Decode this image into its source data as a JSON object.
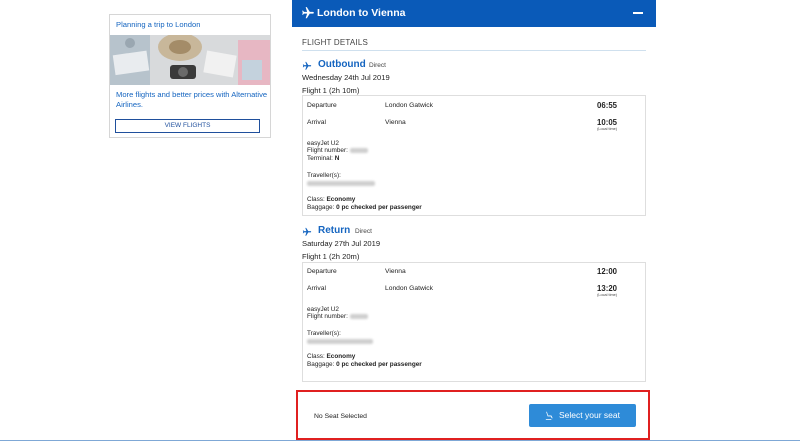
{
  "promo": {
    "title": "Planning a trip to London",
    "text": "More flights and better prices with Alternative Airlines.",
    "button_label": "VIEW FLIGHTS"
  },
  "header": {
    "title": "London to Vienna",
    "collapse_icon": "minus-icon"
  },
  "details": {
    "section_title": "FLIGHT DETAILS"
  },
  "outbound": {
    "name": "Outbound",
    "type": "Direct",
    "date": "Wednesday 24th Jul 2019",
    "flight": "Flight 1 (2h 10m)",
    "departure_label": "Departure",
    "departure_place": "London Gatwick",
    "departure_time": "06:55",
    "arrival_label": "Arrival",
    "arrival_place": "Vienna",
    "arrival_time": "10:05",
    "local_time": "(Local time)",
    "carrier": "easyJet U2",
    "flight_number_label": "Flight number:",
    "terminal_label": "Terminal:",
    "terminal_value": "N",
    "travellers_label": "Traveller(s):",
    "class_label": "Class:",
    "class_value": "Economy",
    "baggage_label": "Baggage:",
    "baggage_value": "0 pc checked per passenger"
  },
  "return": {
    "name": "Return",
    "type": "Direct",
    "date": "Saturday 27th Jul 2019",
    "flight": "Flight 1 (2h 20m)",
    "departure_label": "Departure",
    "departure_place": "Vienna",
    "departure_time": "12:00",
    "arrival_label": "Arrival",
    "arrival_place": "London Gatwick",
    "arrival_time": "13:20",
    "local_time": "(Local time)",
    "carrier": "easyJet U2",
    "flight_number_label": "Flight number:",
    "travellers_label": "Traveller(s):",
    "class_label": "Class:",
    "class_value": "Economy",
    "baggage_label": "Baggage:",
    "baggage_value": "0 pc checked per passenger"
  },
  "seat": {
    "status": "No Seat Selected",
    "button_label": "Select your seat",
    "button_icon": "seat-icon"
  },
  "colors": {
    "header_bg": "#0a5ab8",
    "link_blue": "#1565c0",
    "seat_button": "#2e8bd8",
    "highlight_border": "#e02020"
  }
}
